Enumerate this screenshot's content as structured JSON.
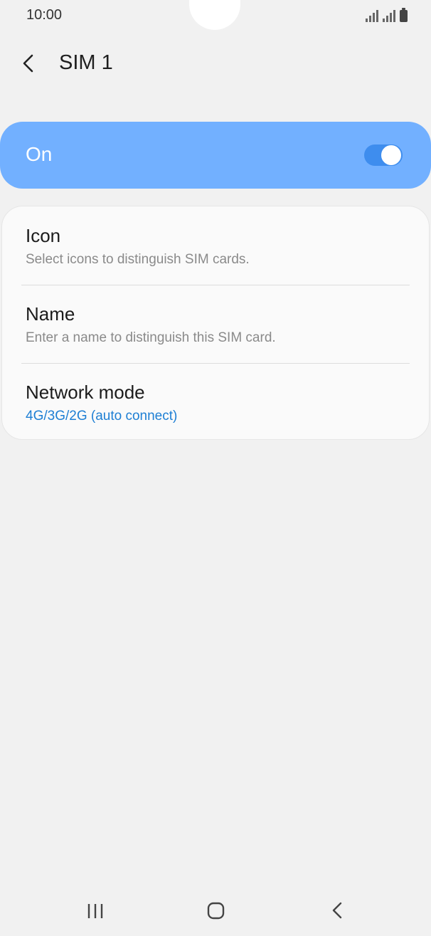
{
  "status_bar": {
    "time": "10:00"
  },
  "header": {
    "title": "SIM 1"
  },
  "sim_toggle": {
    "label": "On",
    "state": "on",
    "color": "#72b0ff"
  },
  "settings": [
    {
      "title": "Icon",
      "subtitle": "Select icons to distinguish SIM cards."
    },
    {
      "title": "Name",
      "subtitle": "Enter a name to distinguish this SIM card."
    },
    {
      "title": "Network mode",
      "subtitle": "4G/3G/2G (auto connect)"
    }
  ],
  "nav_bar": {
    "icons": [
      "recent-apps-icon",
      "home-icon",
      "back-icon"
    ]
  },
  "colors": {
    "accent_blue": "#1e7fd4",
    "toggle_blue": "#3e8dee",
    "background": "#f1f1f1"
  }
}
